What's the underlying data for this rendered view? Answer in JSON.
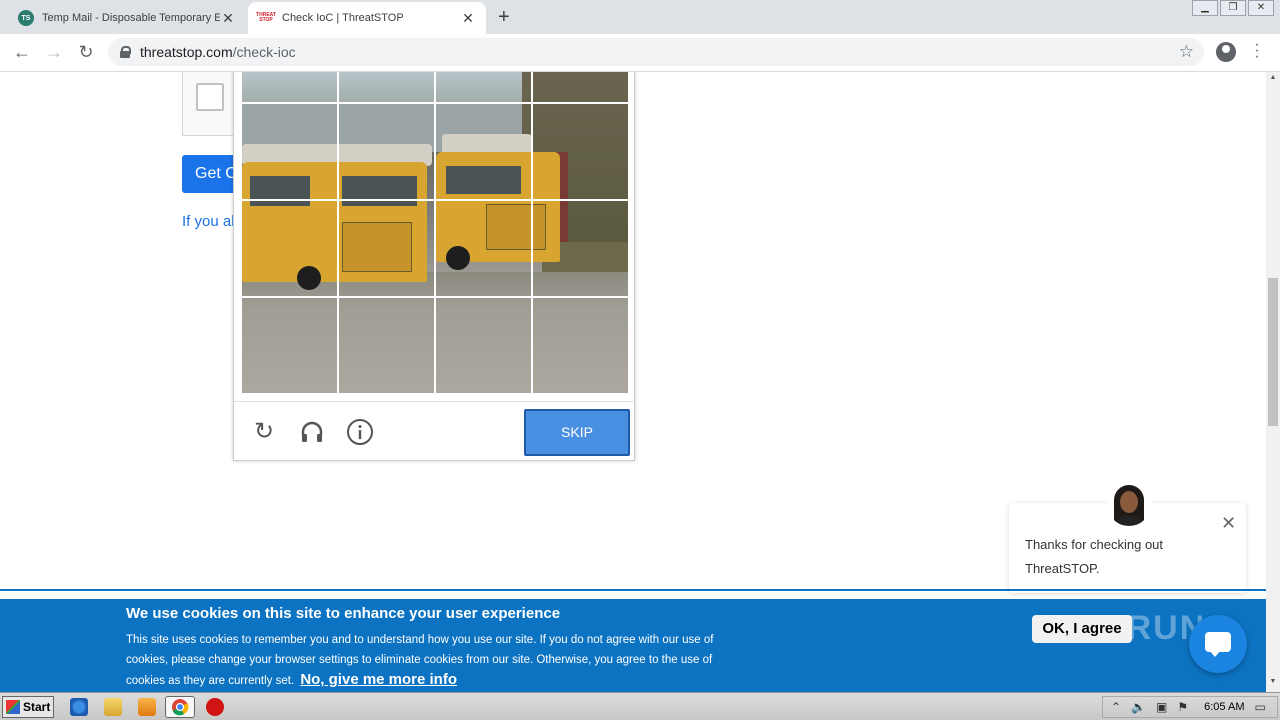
{
  "browser": {
    "tabs": [
      {
        "title": "Temp Mail - Disposable Temporary Email",
        "favicon": "tempmail-icon",
        "active": false
      },
      {
        "title": "Check IoC | ThreatSTOP",
        "favicon": "threatstop-icon",
        "active": true
      }
    ],
    "new_tab_label": "+",
    "url_host": "threatstop.com",
    "url_path": "/check-ioc"
  },
  "page": {
    "get_button_label": "Get C",
    "if_text": "If you al"
  },
  "captcha": {
    "image_subject": "school buses",
    "grid": {
      "rows": 4,
      "cols": 4
    },
    "skip_label": "SKIP",
    "icons": [
      "reload-icon",
      "audio-icon",
      "info-icon"
    ]
  },
  "chat": {
    "message": "Thanks for checking out ThreatSTOP.",
    "close_symbol": "✕"
  },
  "cookie_banner": {
    "title": "We use cookies on this site to enhance your user experience",
    "body": "This site uses cookies to remember you and to understand how you use our site. If you do not agree with our use of cookies, please change your browser settings to eliminate cookies from our site. Otherwise, you agree to the use of cookies as they are currently set.",
    "link": "No, give me more info",
    "ok_label": "OK, I agree",
    "watermark": "ANY RUN",
    "color": "#0c73c2"
  },
  "taskbar": {
    "start_label": "Start",
    "clock": "6:05 AM"
  }
}
